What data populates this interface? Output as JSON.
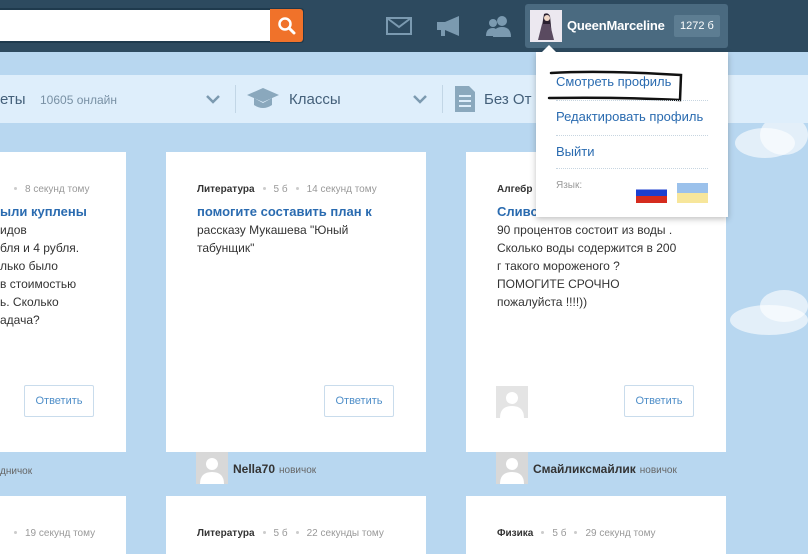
{
  "header": {
    "username": "QueenMarceline",
    "points": "1272 б",
    "icons": [
      "search-icon",
      "mail-icon",
      "megaphone-icon",
      "friends-icon"
    ]
  },
  "filters": {
    "subjects_label": "еты",
    "online_count": "10605 онлайн",
    "classes_label": "Классы",
    "answers_label": "Без От"
  },
  "dropdown": {
    "view_profile": "Смотреть профиль",
    "edit_profile": "Редактировать профиль",
    "logout": "Выйти",
    "language_label": "Язык:",
    "languages": [
      "ru",
      "uk"
    ]
  },
  "cards": [
    {
      "time": "8 секунд тому",
      "title": "ыли куплены",
      "text": "идов\nбля и 4 рубля.\nлько было\nв стоимостью\nь. Сколько\nадача?",
      "answer": "Ответить",
      "author_rank": "дничок"
    },
    {
      "subject": "Литература",
      "points": "5 б",
      "time": "14 секунд тому",
      "title": "помогите составить план к",
      "text": "рассказу Мукашева \"Юный\nтабунщик\"",
      "answer": "Ответить",
      "author_name": "Nella70",
      "author_rank": "новичок"
    },
    {
      "subject": "Алгебр",
      "title": "Сливо",
      "text": "90 процентов состоит из воды .\nСколько воды содержится в 200\nг такого мороженого ?\nПОМОГИТЕ СРОЧНО\nпожалуйста !!!!))",
      "answer": "Ответить",
      "author_name": "Смайликсмайлик",
      "author_rank": "новичок"
    }
  ],
  "cards_row2": [
    {
      "time": "19 секунд тому"
    },
    {
      "subject": "Литература",
      "points": "5 б",
      "time": "22 секунды тому"
    },
    {
      "subject": "Физика",
      "points": "5 б",
      "time": "29 секунд тому"
    }
  ]
}
